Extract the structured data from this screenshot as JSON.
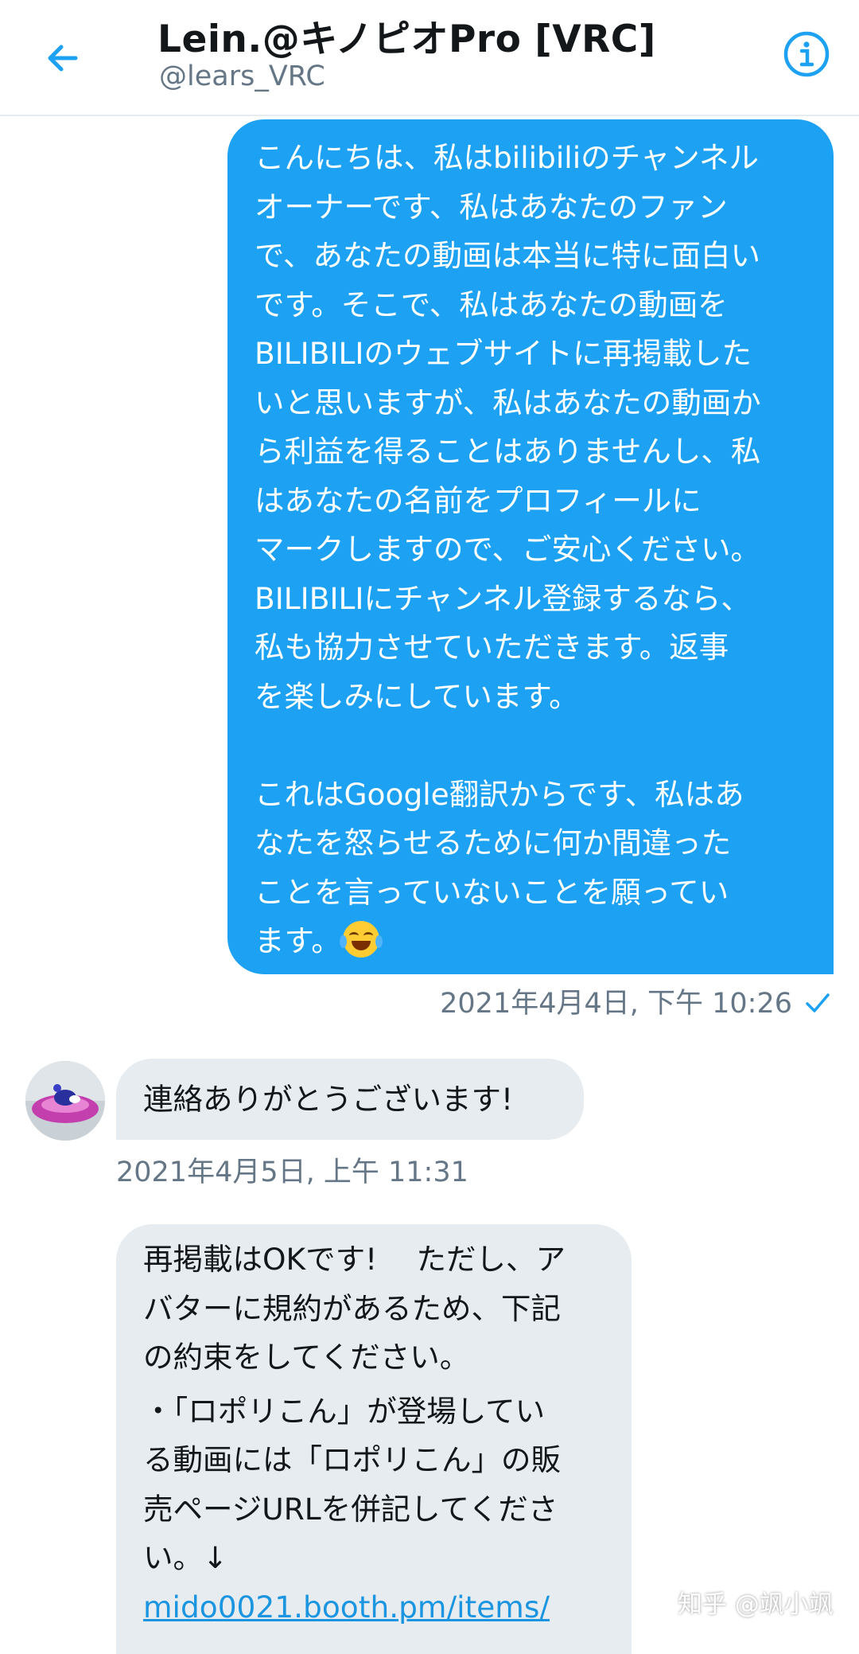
{
  "header": {
    "title": "Lein.@キノピオPro [VRC]",
    "handle": "@lears_VRC",
    "back_icon": "arrow-left-icon",
    "info_icon": "info-icon",
    "accent_color": "#1da1f2"
  },
  "messages": {
    "outgoing": {
      "lines": [
        "こんにちは、私はbilibiliのチャンネル",
        "オーナーです、私はあなたのファン",
        "で、あなたの動画は本当に特に面白い",
        "です。そこで、私はあなたの動画を",
        "BILIBILIのウェブサイトに再掲載した",
        "いと思いますが、私はあなたの動画か",
        "ら利益を得ることはありませんし、私",
        "はあなたの名前をプロフィールに",
        "マークしますので、ご安心ください。",
        "BILIBILIにチャンネル登録するなら、",
        "私も協力させていただきます。返事",
        "を楽しみにしています。"
      ],
      "lines2": [
        "これはGoogle翻訳からです、私はあ",
        "なたを怒らせるために何か間違った",
        "ことを言っていないことを願ってい",
        "ます。"
      ],
      "emoji": "tears-of-joy-icon",
      "timestamp": "2021年4月4日, 下午 10:26",
      "bubble_color": "#1da1f2"
    },
    "incoming1": {
      "text": "連絡ありがとうございます!",
      "timestamp": "2021年4月5日, 上午 11:31",
      "bubble_color": "#e6ecf0"
    },
    "incoming2": {
      "lines": [
        "再掲載はOKです!　 ただし、ア",
        "バターに規約があるため、下記",
        "の約束をしてください。"
      ],
      "lines2": [
        "・「ロポリこん」が登場してい",
        "る動画には「ロポリこん」の販",
        "売ページURLを併記してくださ",
        "い。↓"
      ],
      "link": "mido0021.booth.pm/items/"
    }
  },
  "watermark": "知乎 @飒小飒"
}
